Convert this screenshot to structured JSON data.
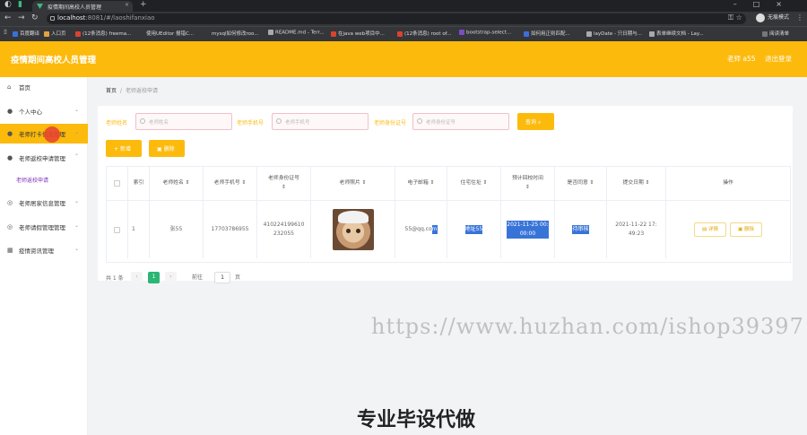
{
  "browser": {
    "tab_title": "疫情期间高校人员管理",
    "url_host": "localhost",
    "url_path": ":8081/#/laoshifanxiao",
    "profile_label": "无痕模式",
    "bookmarks": [
      "百度翻译",
      "入口页",
      "(12条消息) freema...",
      "使用UEditor 报错C...",
      "mysql如何修改roo...",
      "README.md - Terr...",
      "在java web项目中...",
      "(12条消息) root of...",
      "bootstrap-select...",
      "如何用正则匹配...",
      "layDate - 只日期与...",
      "表单继续文档 - Lay..."
    ],
    "reading_list": "阅读清单"
  },
  "header": {
    "title": "疫情期间高校人员管理",
    "user": "老师 a55",
    "logout": "退出登录",
    "color": "#fcba0c"
  },
  "sidebar": {
    "items": [
      {
        "label": "首页",
        "icon": "home-icon"
      },
      {
        "label": "个人中心",
        "icon": "user-icon"
      },
      {
        "label": "老师打卡信息管理",
        "icon": "user-icon"
      },
      {
        "label": "老师返校申请管理",
        "icon": "user-icon"
      },
      {
        "label": "老师返校申请",
        "icon": ""
      },
      {
        "label": "老师居家信息管理",
        "icon": "globe-icon"
      },
      {
        "label": "老师请假管理管理",
        "icon": "globe-icon"
      },
      {
        "label": "疫情资讯管理",
        "icon": "chart-icon"
      }
    ]
  },
  "breadcrumb": {
    "home": "首页",
    "sep": "/",
    "current": "老师返校申请"
  },
  "search": {
    "name_label": "老师姓名",
    "name_placeholder": "老师姓名",
    "phone_label": "老师手机号",
    "phone_placeholder": "老师手机号",
    "id_label": "老师身份证号",
    "id_placeholder": "老师身份证号",
    "query": "查询"
  },
  "actions": {
    "add": "新增",
    "delete": "删除"
  },
  "table": {
    "headers": [
      "索引",
      "老师姓名",
      "老师手机号",
      "老师身份证号",
      "老师照片",
      "电子邮箱",
      "住宅住址",
      "预计回校时间",
      "是否同意",
      "提交日期",
      "操作"
    ],
    "sort_mark": "⇕",
    "row": {
      "index": "1",
      "name": "张55",
      "phone": "17703786955",
      "id_line1": "410224199610",
      "id_line2": "232055",
      "email_a": "55@qq.co",
      "email_b": "m",
      "address": "地址55",
      "return_line1": "2021-11-25 00:",
      "return_line2": "00:00",
      "approve": "待审核",
      "submit_line1": "2021-11-22 17:",
      "submit_line2": "49:23",
      "detail": "详情",
      "remove": "删除"
    }
  },
  "pagination": {
    "total": "共 1 条",
    "page": "1",
    "goto": "前往",
    "goto_value": "1",
    "unit": "页"
  },
  "watermark": "https://www.huzhan.com/ishop39397",
  "slogan": "专业毕设代做"
}
